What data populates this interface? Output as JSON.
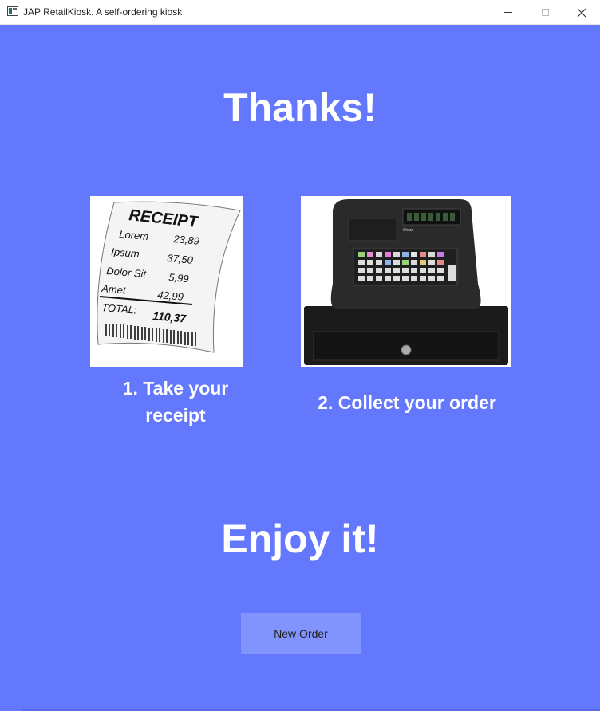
{
  "window": {
    "title": "JAP RetailKiosk. A self-ordering kiosk",
    "app_icon": "app-window-icon",
    "controls": [
      "minimize-icon",
      "maximize-icon",
      "close-icon"
    ]
  },
  "main": {
    "heading": "Thanks!",
    "steps": [
      {
        "label": "1. Take your receipt",
        "image": "receipt-image"
      },
      {
        "label": "2. Collect your order",
        "image": "cash-register-image"
      }
    ],
    "closing": "Enjoy it!",
    "new_order_label": "New Order"
  },
  "receipt": {
    "title": "RECEIPT",
    "lines": [
      {
        "name": "Lorem",
        "price": "23,89"
      },
      {
        "name": "Ipsum",
        "price": "37,50"
      },
      {
        "name": "Dolor Sit",
        "price": "5,99"
      },
      {
        "name": "Amet",
        "price": "42,99"
      }
    ],
    "total_label": "TOTAL:",
    "total_value": "110,37"
  },
  "register": {
    "brand": "Sharp"
  },
  "colors": {
    "background": "#6378fd",
    "button": "#8194fe",
    "text": "#ffffff"
  }
}
